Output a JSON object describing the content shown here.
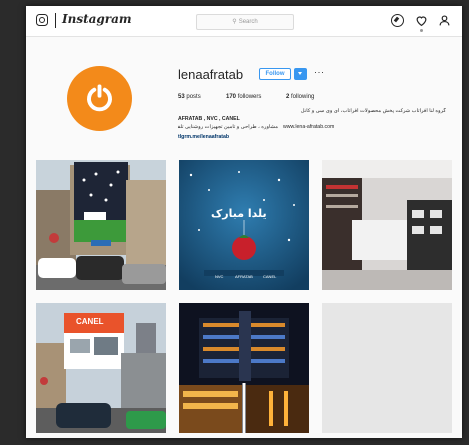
{
  "topbar": {
    "wordmark": "Instagram",
    "search_placeholder": "Search",
    "icons": [
      "camera-logo-icon",
      "compass-icon",
      "heart-icon",
      "person-icon"
    ]
  },
  "profile": {
    "username": "lenaafratab",
    "follow_label": "Follow",
    "more_label": "···",
    "stats": {
      "posts_count": "53",
      "posts_label": "posts",
      "followers_count": "170",
      "followers_label": "followers",
      "following_count": "2",
      "following_label": "following"
    },
    "bio_line1": "گروه لنا افراتاب شرکت پخش محصولات افراتاب، آی وی سی و کانل",
    "bio_line2": "AFRATAB , NVC , CANEL",
    "bio_line3": "مشاوره ، طراحی و تامین تجهیزات روشنایی تلفن: ۶۶۳۹۴۰۰۰",
    "bio_website": "www.lena-afratab.com",
    "bio_link": "tlgrm.me/lenaafratab"
  },
  "posts": [
    {
      "id": "post-1",
      "desc": "building-banner"
    },
    {
      "id": "post-2",
      "desc": "yalda-greeting",
      "text": "یلدا مبارک",
      "logos": [
        "NVC",
        "AFRATAB",
        "CANEL"
      ]
    },
    {
      "id": "post-3",
      "desc": "shop-interior"
    },
    {
      "id": "post-4",
      "desc": "canel-billboard",
      "text": "CANEL"
    },
    {
      "id": "post-5",
      "desc": "mall-night"
    },
    {
      "id": "post-6",
      "desc": "empty"
    }
  ],
  "colors": {
    "accent_blue": "#3897f0",
    "avatar_orange": "#f38a1a"
  }
}
